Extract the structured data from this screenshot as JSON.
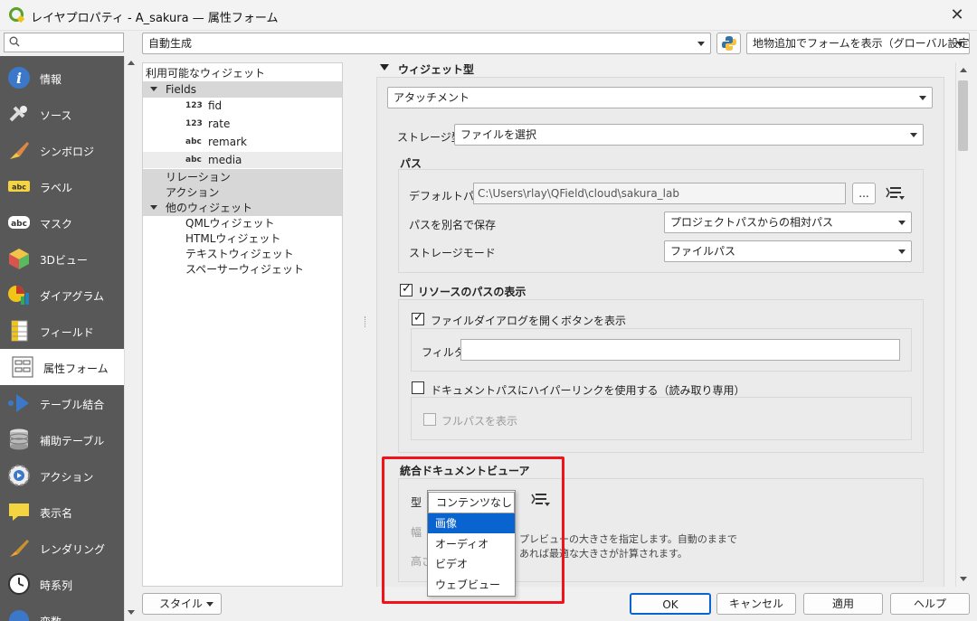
{
  "window": {
    "title": "レイヤプロパティ - A_sakura — 属性フォーム"
  },
  "sidebar": {
    "search_placeholder": "",
    "items": [
      {
        "label": "情報",
        "icon": "info-icon"
      },
      {
        "label": "ソース",
        "icon": "source-icon"
      },
      {
        "label": "シンボロジ",
        "icon": "symbology-icon"
      },
      {
        "label": "ラベル",
        "icon": "label-icon"
      },
      {
        "label": "マスク",
        "icon": "mask-icon"
      },
      {
        "label": "3Dビュー",
        "icon": "3d-view-icon"
      },
      {
        "label": "ダイアグラム",
        "icon": "diagram-icon"
      },
      {
        "label": "フィールド",
        "icon": "fields-icon"
      },
      {
        "label": "属性フォーム",
        "icon": "attribute-form-icon"
      },
      {
        "label": "テーブル結合",
        "icon": "joins-icon"
      },
      {
        "label": "補助テーブル",
        "icon": "auxiliary-storage-icon"
      },
      {
        "label": "アクション",
        "icon": "actions-icon"
      },
      {
        "label": "表示名",
        "icon": "display-icon"
      },
      {
        "label": "レンダリング",
        "icon": "rendering-icon"
      },
      {
        "label": "時系列",
        "icon": "temporal-icon"
      },
      {
        "label": "変数",
        "icon": "variables-icon"
      }
    ]
  },
  "toolbar": {
    "form_mode": "自動生成",
    "global_setting": "地物追加でフォームを表示（グローバル設定）"
  },
  "tree": {
    "header": "利用可能なウィジェット",
    "fields_label": "Fields",
    "fields": [
      {
        "type": "123",
        "name": "fid"
      },
      {
        "type": "123",
        "name": "rate"
      },
      {
        "type": "abc",
        "name": "remark"
      },
      {
        "type": "abc",
        "name": "media"
      }
    ],
    "relations": "リレーション",
    "actions": "アクション",
    "other_widgets": "他のウィジェット",
    "other_items": [
      "QMLウィジェット",
      "HTMLウィジェット",
      "テキストウィジェット",
      "スペーサーウィジェット"
    ]
  },
  "widget": {
    "section_title": "ウィジェット型",
    "type_value": "アタッチメント",
    "storage_label": "ストレージ型",
    "storage_value": "ファイルを選択",
    "path_group": "パス",
    "default_path_label": "デフォルトパス",
    "default_path_value": "C:\\Users\\rlay\\QField\\cloud\\sakura_lab",
    "browse_label": "...",
    "save_as_label": "パスを別名で保存",
    "save_as_value": "プロジェクトパスからの相対パス",
    "storage_mode_label": "ストレージモード",
    "storage_mode_value": "ファイルパス",
    "show_resource_path": "リソースのパスの表示",
    "show_file_dialog_button": "ファイルダイアログを開くボタンを表示",
    "filter_label": "フィルタ",
    "filter_value": "",
    "hyperlink_label": "ドキュメントパスにハイパーリンクを使用する（読み取り専用）",
    "full_path_label": "フルパスを表示",
    "viewer_title": "統合ドキュメントビューア",
    "viewer_type_label": "型",
    "viewer_type_value": "コンテンツなし",
    "width_label": "幅",
    "height_label": "高さ",
    "help_line1": "プレビューの大きさを指定します。自動のままで",
    "help_line2": "あれば最適な大きさが計算されます。",
    "dropdown_options": [
      "画像",
      "オーディオ",
      "ビデオ",
      "ウェブビュー"
    ],
    "dropdown_selected": "画像"
  },
  "footer": {
    "style_label": "スタイル",
    "ok_label": "OK",
    "cancel_label": "キャンセル",
    "apply_label": "適用",
    "help_label": "ヘルプ"
  },
  "colors": {
    "accent": "#0a64d0",
    "highlight_box": "#f0131b",
    "sidebar_bg": "#585858"
  }
}
